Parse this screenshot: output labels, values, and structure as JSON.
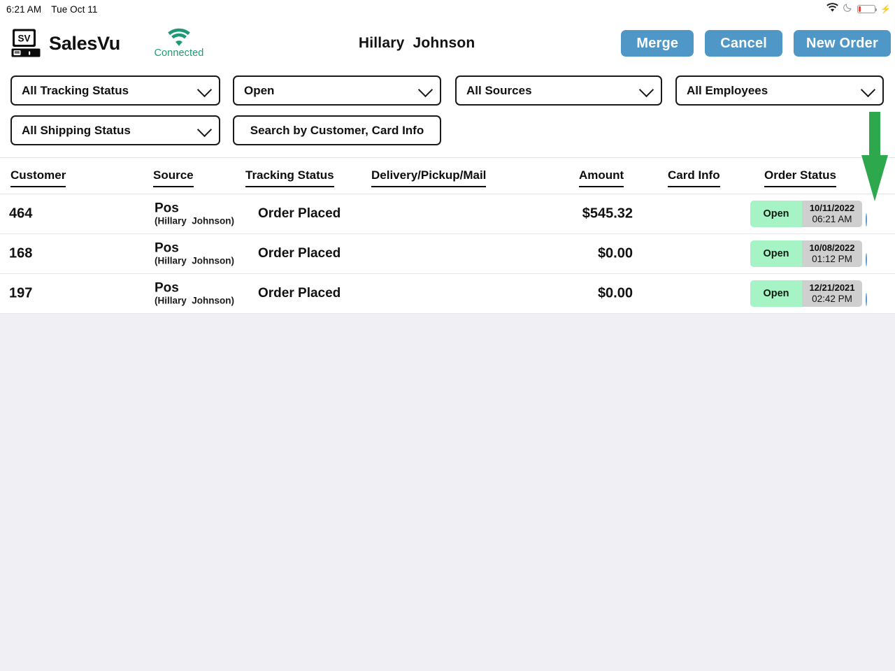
{
  "status_bar": {
    "time": "6:21 AM",
    "date": "Tue Oct 11",
    "icons": [
      "wifi-icon",
      "moon-icon",
      "battery-icon",
      "charging-bolt-icon"
    ],
    "battery_level_percent": 12
  },
  "header": {
    "logo_text": "SV",
    "brand_name": "SalesVu",
    "connection_label": "Connected",
    "connection_color": "#1d9a74",
    "title": "Hillary  Johnson",
    "buttons": [
      {
        "label": "Merge",
        "name": "merge-button"
      },
      {
        "label": "Cancel",
        "name": "cancel-button"
      },
      {
        "label": "New Order",
        "name": "new-order-button"
      }
    ],
    "button_color": "#4f97c6"
  },
  "filters": {
    "tracking_status": {
      "value": "All Tracking Status"
    },
    "order_state": {
      "value": "Open"
    },
    "sources": {
      "value": "All Sources"
    },
    "employees": {
      "value": "All Employees"
    },
    "shipping_status": {
      "value": "All Shipping Status"
    },
    "search": {
      "placeholder": "Search by Customer, Card Info",
      "value": ""
    }
  },
  "table": {
    "columns": [
      "Customer",
      "Source",
      "Tracking Status",
      "Delivery/Pickup/Mail",
      "Amount",
      "Card Info",
      "Order Status"
    ],
    "rows": [
      {
        "customer": "464",
        "source": "Pos",
        "source_employee": "(Hillary  Johnson)",
        "tracking_status": "Order Placed",
        "delivery": "",
        "amount": "$545.32",
        "card_info": "",
        "order_status": "Open",
        "order_date": "10/11/2022",
        "order_time": "06:21 AM"
      },
      {
        "customer": "168",
        "source": "Pos",
        "source_employee": "(Hillary  Johnson)",
        "tracking_status": "Order Placed",
        "delivery": "",
        "amount": "$0.00",
        "card_info": "",
        "order_status": "Open",
        "order_date": "10/08/2022",
        "order_time": "01:12 PM"
      },
      {
        "customer": "197",
        "source": "Pos",
        "source_employee": "(Hillary  Johnson)",
        "tracking_status": "Order Placed",
        "delivery": "",
        "amount": "$0.00",
        "card_info": "",
        "order_status": "Open",
        "order_date": "12/21/2021",
        "order_time": "02:42 PM"
      }
    ],
    "status_badge_color": "#a6f4c5",
    "date_badge_color": "#cfcfcf",
    "add_button_color": "#5b9dd0"
  },
  "annotation": {
    "type": "down-arrow",
    "color": "#2ea84d",
    "points_to": "expand-row-464-button"
  }
}
